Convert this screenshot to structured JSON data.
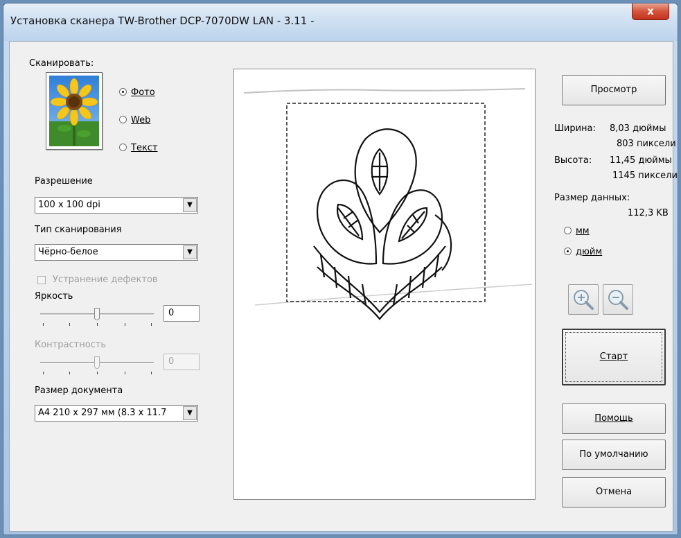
{
  "window": {
    "title": "Установка сканера TW-Brother DCP-7070DW LAN - 3.11 -",
    "close_label": "x"
  },
  "scan": {
    "label": "Сканировать:",
    "options": [
      {
        "label": "Фото",
        "selected": true
      },
      {
        "label": "Web",
        "selected": false
      },
      {
        "label": "Текст",
        "selected": false
      }
    ]
  },
  "resolution": {
    "label": "Разрешение",
    "value": "100 x 100 dpi"
  },
  "scan_type": {
    "label": "Тип сканирования",
    "value": "Чёрно-белое"
  },
  "descreen": {
    "label": "Устранение дефектов",
    "checked": false,
    "enabled": false
  },
  "brightness": {
    "label": "Яркость",
    "value": "0",
    "level": 0.5
  },
  "contrast": {
    "label": "Контрастность",
    "value": "0",
    "level": 0.5,
    "enabled": false
  },
  "doc_size": {
    "label": "Размер документа",
    "value": "A4 210 x 297 мм (8.3 x 11.7"
  },
  "right": {
    "preview_button": "Просмотр",
    "width_label": "Ширина:",
    "width_in": "8,03 дюймы",
    "width_px": "803 пиксели",
    "height_label": "Высота:",
    "height_in": "11,45 дюймы",
    "height_px": "1145 пиксели",
    "data_size_label": "Размер данных:",
    "data_size_value": "112,3 KB",
    "units": [
      {
        "label": "мм",
        "selected": false
      },
      {
        "label": "дюйм",
        "selected": true
      }
    ],
    "start_button": "Старт",
    "help_button": "Помощь",
    "default_button": "По умолчанию",
    "cancel_button": "Отмена"
  },
  "icons": {
    "photo": "sunflower-photo-icon",
    "zoom_in": "zoom-in-icon",
    "zoom_out": "zoom-out-icon"
  }
}
